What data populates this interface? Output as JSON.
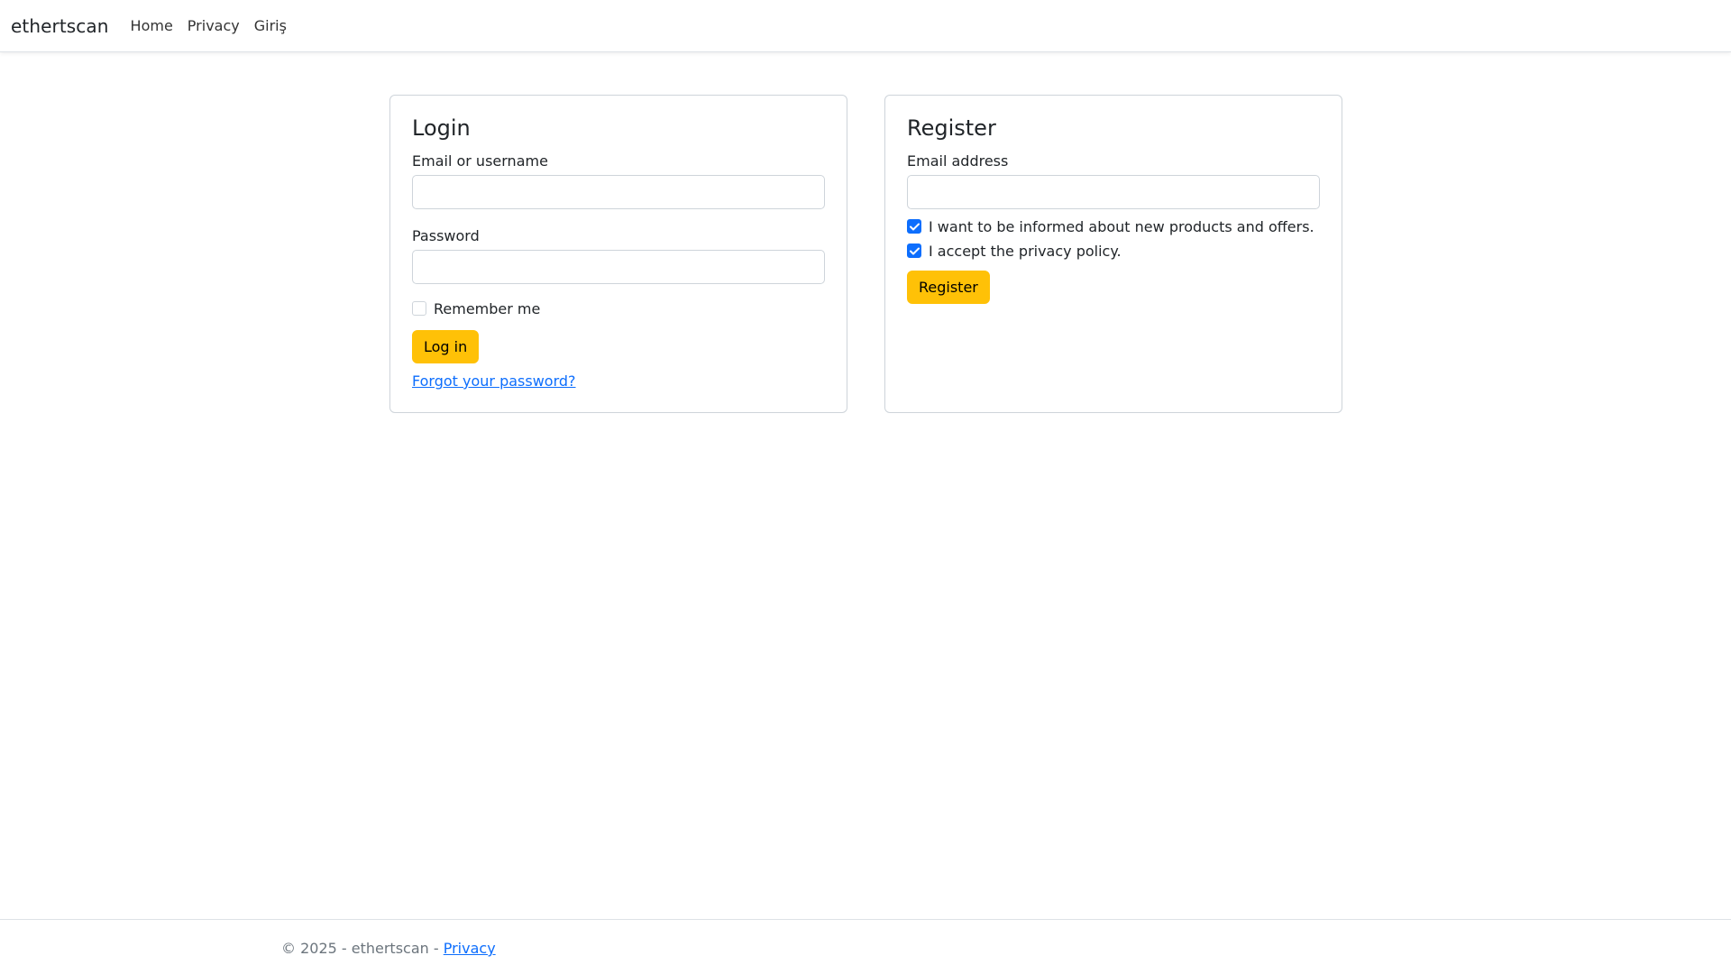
{
  "navbar": {
    "brand": "ethertscan",
    "links": [
      "Home",
      "Privacy",
      "Giriş"
    ]
  },
  "login": {
    "title": "Login",
    "email_label": "Email or username",
    "email_value": "",
    "password_label": "Password",
    "password_value": "",
    "remember_label": "Remember me",
    "remember_checked": false,
    "submit_label": "Log in",
    "forgot_label": "Forgot your password?"
  },
  "register": {
    "title": "Register",
    "email_label": "Email address",
    "email_value": "",
    "newsletter_label": "I want to be informed about new products and offers.",
    "newsletter_checked": true,
    "privacy_label": "I accept the privacy policy.",
    "privacy_checked": true,
    "submit_label": "Register"
  },
  "footer": {
    "copyright": "© 2025 - ethertscan - ",
    "privacy_link": "Privacy"
  },
  "colors": {
    "accent_yellow": "#ffc107",
    "checkbox_blue": "#0d6efd",
    "link_blue": "#0d6efd"
  }
}
